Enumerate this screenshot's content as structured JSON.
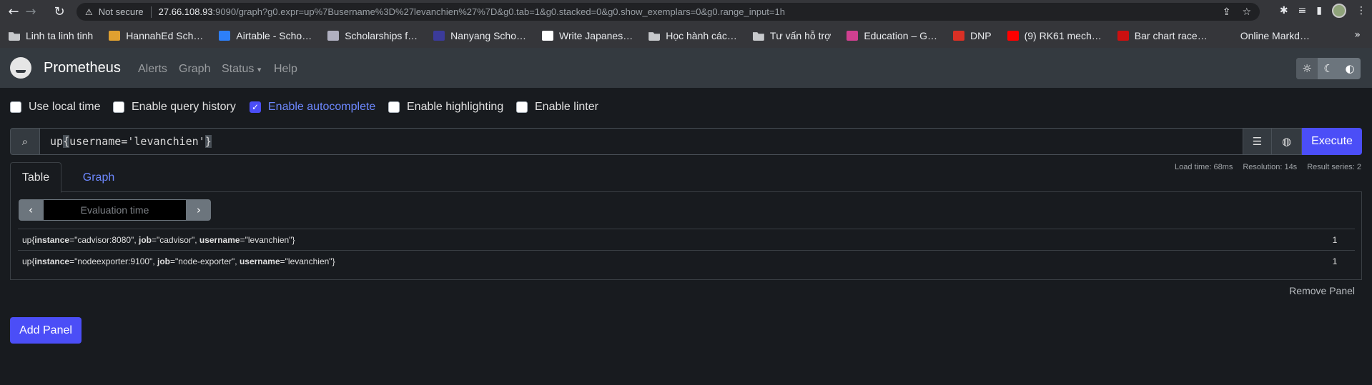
{
  "browser": {
    "back_icon": "arrow-left-icon",
    "forward_icon": "arrow-right-icon",
    "reload_icon": "reload-icon",
    "security_label": "Not secure",
    "url_host": "27.66.108.93",
    "url_rest": ":9090/graph?g0.expr=up%7Busername%3D%27levanchien%27%7D&g0.tab=1&g0.stacked=0&g0.show_exemplars=0&g0.range_input=1h"
  },
  "bookmarks": [
    {
      "label": "Linh ta linh tinh",
      "icon": "folder",
      "color": "#c7c9cc"
    },
    {
      "label": "HannahEd Sch…",
      "icon": "hannahed-logo",
      "color": "#e0a030"
    },
    {
      "label": "Airtable - Scho…",
      "icon": "airtable-logo",
      "color": "#2d7ff9"
    },
    {
      "label": "Scholarships f…",
      "icon": "crest-logo",
      "color": "#b0b0c0"
    },
    {
      "label": "Nanyang Scho…",
      "icon": "ntu-logo",
      "color": "#3b3b9a"
    },
    {
      "label": "Write Japanes…",
      "icon": "ja-logo",
      "color": "#ffffff"
    },
    {
      "label": "Học hành các…",
      "icon": "folder",
      "color": "#c7c9cc"
    },
    {
      "label": "Tư vấn hỗ trợ",
      "icon": "folder",
      "color": "#c7c9cc"
    },
    {
      "label": "Education – G…",
      "icon": "education-logo",
      "color": "#d04090"
    },
    {
      "label": "DNP",
      "icon": "dnp-logo",
      "color": "#d93025"
    },
    {
      "label": "(9) RK61 mech…",
      "icon": "youtube-logo",
      "color": "#ff0000"
    },
    {
      "label": "Bar chart race…",
      "icon": "record-logo",
      "color": "#cc1010"
    },
    {
      "label": "Online Markd…",
      "icon": "d-logo",
      "color": "#35363a"
    }
  ],
  "prom_nav": {
    "brand": "Prometheus",
    "links": [
      "Alerts",
      "Graph",
      "Status",
      "Help"
    ],
    "status_caret": "▾"
  },
  "options": [
    {
      "label": "Use local time",
      "checked": false
    },
    {
      "label": "Enable query history",
      "checked": false
    },
    {
      "label": "Enable autocomplete",
      "checked": true
    },
    {
      "label": "Enable highlighting",
      "checked": false
    },
    {
      "label": "Enable linter",
      "checked": false
    }
  ],
  "expression": {
    "prefix": "up",
    "open_brace": "{",
    "body": "username='levanchien'",
    "close_brace": "}",
    "execute_label": "Execute"
  },
  "stats": {
    "load_time": "Load time: 68ms",
    "resolution": "Resolution: 14s",
    "result_series": "Result series: 2"
  },
  "tabs": {
    "table": "Table",
    "graph": "Graph"
  },
  "eval_time_placeholder": "Evaluation time",
  "results": [
    {
      "metric": "up",
      "labels": [
        {
          "k": "instance",
          "v": "\"cadvisor:8080\""
        },
        {
          "k": "job",
          "v": "\"cadvisor\""
        },
        {
          "k": "username",
          "v": "\"levanchien\""
        }
      ],
      "value": "1"
    },
    {
      "metric": "up",
      "labels": [
        {
          "k": "instance",
          "v": "\"nodeexporter:9100\""
        },
        {
          "k": "job",
          "v": "\"node-exporter\""
        },
        {
          "k": "username",
          "v": "\"levanchien\""
        }
      ],
      "value": "1"
    }
  ],
  "remove_panel": "Remove Panel",
  "add_panel": "Add Panel"
}
